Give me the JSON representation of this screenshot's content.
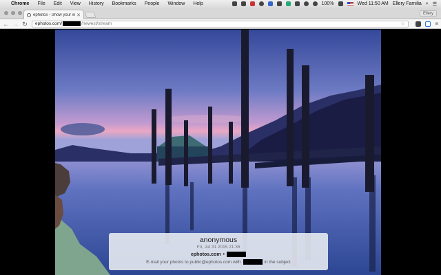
{
  "menubar": {
    "app": "Chrome",
    "items": [
      "File",
      "Edit",
      "View",
      "History",
      "Bookmarks",
      "People",
      "Window",
      "Help"
    ],
    "battery": "100%",
    "clock": "Wed 11:50 AM",
    "user": "Ellery Familia"
  },
  "tab": {
    "title": "ephotos - Show your world"
  },
  "profile": {
    "name": "Ellery"
  },
  "address": {
    "host": "ephotos.com/",
    "path": "/newest/stream"
  },
  "caption": {
    "author": "anonymous",
    "date": "Fri, Jul 31 2015 21:36",
    "site": "ephotos.com",
    "separator": "•",
    "email_prefix": "E-mail your photos to public@ephotos.com with",
    "email_suffix": "in the subject"
  },
  "colors": {
    "sky_top": "#3a4fa0",
    "sky_mid": "#7d86c8",
    "sunset": "#e3a3c7",
    "water": "#3c5aa6"
  }
}
